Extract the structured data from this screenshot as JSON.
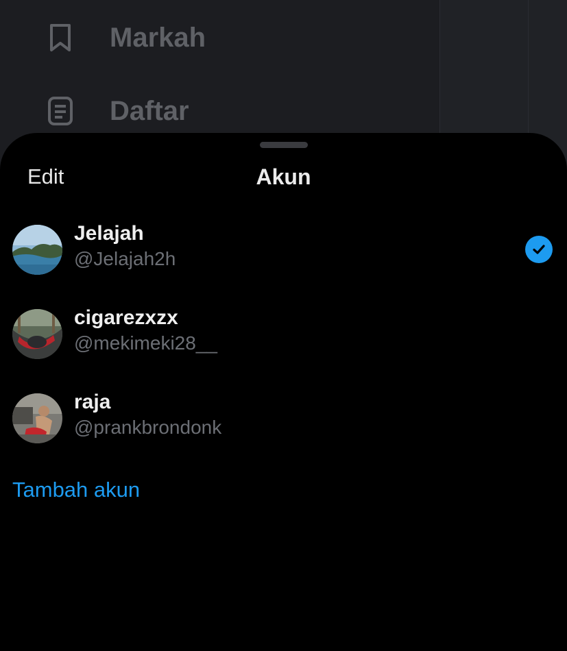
{
  "background_nav": {
    "items": [
      {
        "label": "Markah",
        "icon": "bookmark-icon"
      },
      {
        "label": "Daftar",
        "icon": "list-icon"
      }
    ]
  },
  "sheet": {
    "edit_label": "Edit",
    "title": "Akun",
    "accounts": [
      {
        "name": "Jelajah",
        "handle": "@Jelajah2h",
        "selected": true,
        "avatar": "landscape-photo"
      },
      {
        "name": "cigarezxzx",
        "handle": "@mekimeki28__",
        "selected": false,
        "avatar": "hammock-photo"
      },
      {
        "name": "raja",
        "handle": "@prankbrondonk",
        "selected": false,
        "avatar": "person-photo"
      }
    ],
    "add_account_label": "Tambah akun"
  },
  "colors": {
    "accent": "#1d9bf0",
    "sheet_bg": "#000000",
    "backdrop_bg": "#1c1d21"
  }
}
